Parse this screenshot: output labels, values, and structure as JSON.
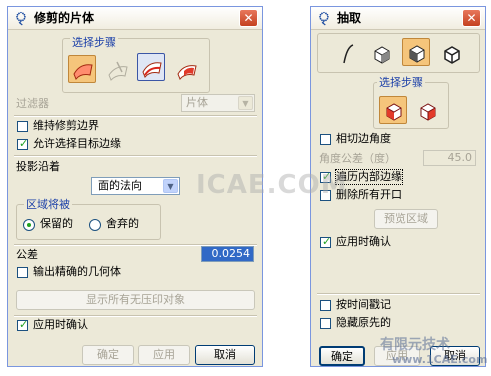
{
  "left_dialog": {
    "title": "修剪的片体",
    "select_steps_label": "选择步骤",
    "filter_label": "过滤器",
    "filter_value": "片体",
    "keep_trim_boundary": "维持修剪边界",
    "allow_target_edge": "允许选择目标边缘",
    "projection_label": "投影沿着",
    "projection_value": "面的法向",
    "region_label": "区域将被",
    "region_keep": "保留的",
    "region_discard": "舍弃的",
    "tolerance_label": "公差",
    "tolerance_value": "0.0254",
    "output_exact": "输出精确的几何体",
    "show_unimprinted": "显示所有无压印对象",
    "confirm_on_apply": "应用时确认",
    "ok": "确定",
    "apply": "应用",
    "cancel": "取消"
  },
  "right_dialog": {
    "title": "抽取",
    "select_steps_label": "选择步骤",
    "tangent_angle": "相切边角度",
    "angle_tol_label": "角度公差（度）",
    "angle_tol_value": "45.0",
    "traverse_inner_edges": "遍历内部边缘",
    "delete_all_openings": "删除所有开口",
    "preview_region": "预览区域",
    "confirm_on_apply": "应用时确认",
    "timestamp": "按时间戳记",
    "hide_original": "隐藏原先的",
    "ok": "确定",
    "apply": "应用",
    "cancel": "取消"
  },
  "watermark": {
    "text": "ICAE.COM",
    "corner_text": "有限元技术",
    "corner_url": "www.1CAE.com"
  }
}
